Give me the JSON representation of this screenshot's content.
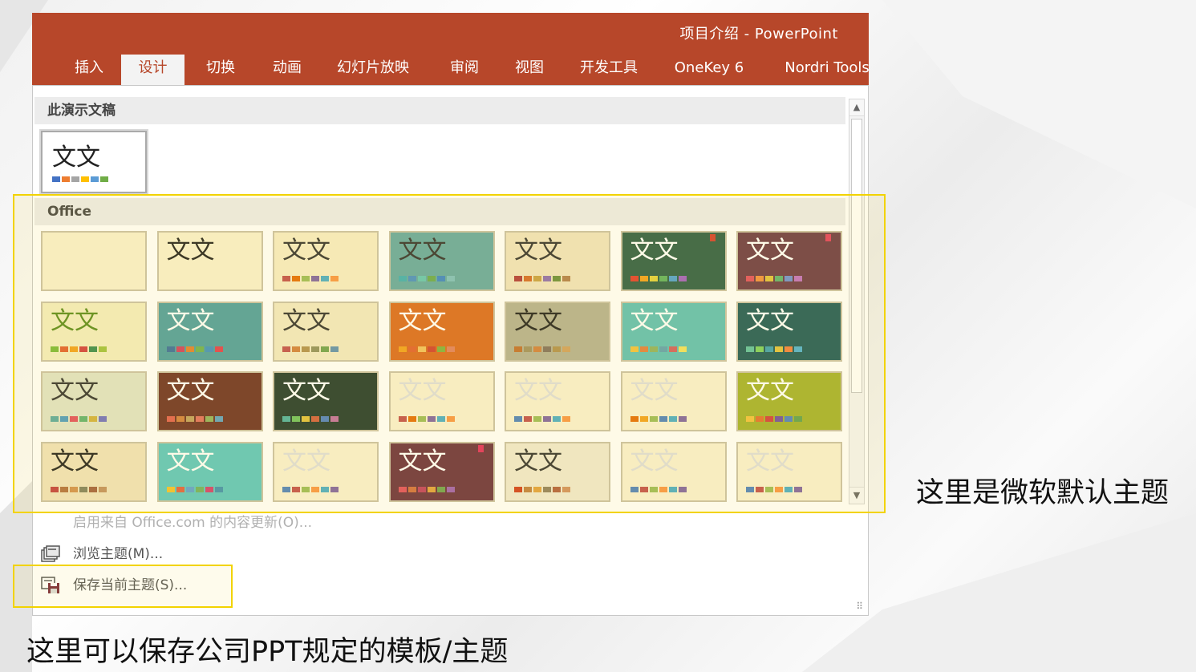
{
  "window": {
    "title": "项目介绍 - PowerPoint"
  },
  "ribbon": {
    "tabs": [
      {
        "label": "插入",
        "active": false
      },
      {
        "label": "设计",
        "active": true
      },
      {
        "label": "切换",
        "active": false
      },
      {
        "label": "动画",
        "active": false
      },
      {
        "label": "幻灯片放映",
        "active": false
      },
      {
        "label": "审阅",
        "active": false
      },
      {
        "label": "视图",
        "active": false
      },
      {
        "label": "开发工具",
        "active": false
      },
      {
        "label": "OneKey 6",
        "active": false
      },
      {
        "label": "Nordri Tools",
        "active": false
      }
    ],
    "accent_color": "#b7472a"
  },
  "gallery": {
    "current_section": "此演示文稿",
    "office_section": "Office",
    "current_theme": {
      "text": "文文",
      "swatches": [
        "#4472c4",
        "#ed7d31",
        "#a5a5a5",
        "#ffc000",
        "#5b9bd5",
        "#70ad47"
      ]
    },
    "themes": [
      {
        "text": "",
        "bg": "#f8f0cf",
        "fg": "#333",
        "swatches": []
      },
      {
        "text": "文文",
        "bg": "#f8f0cf",
        "fg": "#222",
        "swatches": []
      },
      {
        "text": "文文",
        "bg": "#f6ecc6",
        "fg": "#333",
        "swatches": [
          "#c0504d",
          "#e36c09",
          "#9bbb59",
          "#8064a2",
          "#4bacc6",
          "#f79646"
        ]
      },
      {
        "text": "文文",
        "bg": "#66a8a2",
        "fg": "#333",
        "swatches": [
          "#41aeb2",
          "#4a8fc4",
          "#64c5b4",
          "#6aa84f",
          "#3d85c6",
          "#7fbfbf"
        ]
      },
      {
        "text": "文文",
        "bg": "#efe3bf",
        "fg": "#333",
        "swatches": [
          "#b03c3c",
          "#d46b2a",
          "#c7a047",
          "#8e6fb0",
          "#6b8e3d",
          "#b07f4d"
        ]
      },
      {
        "text": "文文",
        "bg": "#2e5e48",
        "fg": "#fff",
        "swatches": [
          "#e04030",
          "#f0a020",
          "#e0d040",
          "#60b060",
          "#50a0d0",
          "#a060c0"
        ],
        "tag": "#d04030"
      },
      {
        "text": "文文",
        "bg": "#6b3a48",
        "fg": "#fff",
        "swatches": [
          "#e05060",
          "#f09040",
          "#e0c040",
          "#60b070",
          "#7090d0",
          "#c070c0"
        ],
        "tag": "#e04060"
      },
      {
        "text": "文文",
        "bg": "#f3edc0",
        "fg": "#5a8a20",
        "swatches": [
          "#7ab83a",
          "#e06030",
          "#f0a020",
          "#d04040",
          "#3a8a50",
          "#a0c040"
        ]
      },
      {
        "text": "文文",
        "bg": "#4f9ea0",
        "fg": "#fff",
        "swatches": [
          "#3a6e9e",
          "#d04060",
          "#e08030",
          "#70b050",
          "#4090c0",
          "#e04050"
        ]
      },
      {
        "text": "文文",
        "bg": "#f2e8c4",
        "fg": "#333",
        "swatches": [
          "#c05050",
          "#d08040",
          "#b09050",
          "#909060",
          "#70a050",
          "#6090b0"
        ]
      },
      {
        "text": "文文",
        "bg": "#d96a22",
        "fg": "#fff",
        "swatches": [
          "#f0a020",
          "#e06030",
          "#f0c060",
          "#d04030",
          "#80b040",
          "#e08060"
        ]
      },
      {
        "text": "文文",
        "bg": "#b4b094",
        "fg": "#222",
        "swatches": [
          "#c07030",
          "#a09060",
          "#d08040",
          "#807060",
          "#b09050",
          "#d0a060"
        ]
      },
      {
        "text": "文文",
        "bg": "#5fbfb6",
        "fg": "#fff",
        "swatches": [
          "#f0c040",
          "#e08040",
          "#90b060",
          "#60a0b0",
          "#d06060",
          "#f0e060"
        ]
      },
      {
        "text": "文文",
        "bg": "#1f5a5a",
        "fg": "#fff",
        "swatches": [
          "#60c0a0",
          "#80d060",
          "#40a0b0",
          "#e0c040",
          "#f08040",
          "#50b0d0"
        ]
      },
      {
        "text": "文文",
        "bg": "#dfe3c8",
        "fg": "#333",
        "swatches": [
          "#5aa8a0",
          "#4c9ac0",
          "#e05060",
          "#60b070",
          "#d0b040",
          "#7070c0"
        ]
      },
      {
        "text": "文文",
        "bg": "#6d3226",
        "fg": "#fff",
        "swatches": [
          "#e06050",
          "#d08040",
          "#c0a060",
          "#e07060",
          "#90b060",
          "#60a0c0"
        ]
      },
      {
        "text": "文文",
        "bg": "#233a2e",
        "fg": "#fff",
        "swatches": [
          "#4fb0a0",
          "#70c060",
          "#e0c040",
          "#d06040",
          "#5080c0",
          "#c070a0"
        ]
      },
      {
        "text": "文文",
        "bg": "#f8f1d3",
        "fg": "#ddd",
        "swatches": [
          "#c0504d",
          "#e36c09",
          "#9bbb59",
          "#8064a2",
          "#4bacc6",
          "#f79646"
        ]
      },
      {
        "text": "文文",
        "bg": "#f8f1d3",
        "fg": "#ddd",
        "swatches": [
          "#4f81bd",
          "#c0504d",
          "#9bbb59",
          "#8064a2",
          "#4bacc6",
          "#f79646"
        ]
      },
      {
        "text": "文文",
        "bg": "#f8f1d3",
        "fg": "#ddd",
        "swatches": [
          "#e36c09",
          "#f0a020",
          "#9bbb59",
          "#4f81bd",
          "#4bacc6",
          "#8064a2"
        ]
      },
      {
        "text": "文文",
        "bg": "#a4b02e",
        "fg": "#fff",
        "swatches": [
          "#f0c040",
          "#e07030",
          "#d04040",
          "#7050a0",
          "#5080c0",
          "#60a050"
        ]
      },
      {
        "text": "文文",
        "bg": "#efe2bc",
        "fg": "#222",
        "swatches": [
          "#c04040",
          "#b07040",
          "#d09050",
          "#808060",
          "#a06040",
          "#c09060"
        ]
      },
      {
        "text": "文文",
        "bg": "#5cc6c0",
        "fg": "#fff",
        "swatches": [
          "#f0c030",
          "#e06040",
          "#60a0d0",
          "#70b060",
          "#d04070",
          "#4090b0"
        ]
      },
      {
        "text": "文文",
        "bg": "#f8f1d3",
        "fg": "#ddd",
        "swatches": [
          "#4f81bd",
          "#c0504d",
          "#9bbb59",
          "#f79646",
          "#4bacc6",
          "#8064a2"
        ]
      },
      {
        "text": "文文",
        "bg": "#6a3140",
        "fg": "#fff",
        "swatches": [
          "#e05060",
          "#d07040",
          "#c04060",
          "#e0a040",
          "#70a050",
          "#a060b0"
        ],
        "tag": "#e03060"
      },
      {
        "text": "文文",
        "bg": "#efe8d2",
        "fg": "#333",
        "swatches": [
          "#d04020",
          "#c08040",
          "#e0a040",
          "#908060",
          "#b06040",
          "#d09060"
        ]
      },
      {
        "text": "文文",
        "bg": "#f8f1d3",
        "fg": "#ddd",
        "swatches": [
          "#4f81bd",
          "#c0504d",
          "#9bbb59",
          "#f79646",
          "#4bacc6",
          "#8064a2"
        ]
      },
      {
        "text": "文文",
        "bg": "#f8f1d3",
        "fg": "#ddd",
        "swatches": [
          "#4f81bd",
          "#c0504d",
          "#9bbb59",
          "#f79646",
          "#4bacc6",
          "#8064a2"
        ]
      }
    ]
  },
  "menu": {
    "update_label": "启用来自 Office.com 的内容更新(O)...",
    "browse_label": "浏览主题(M)...",
    "save_label": "保存当前主题(S)..."
  },
  "annotations": {
    "right_note": "这里是微软默认主题",
    "bottom_note": "这里可以保存公司PPT规定的模板/主题",
    "highlight_color": "#f2d300"
  }
}
